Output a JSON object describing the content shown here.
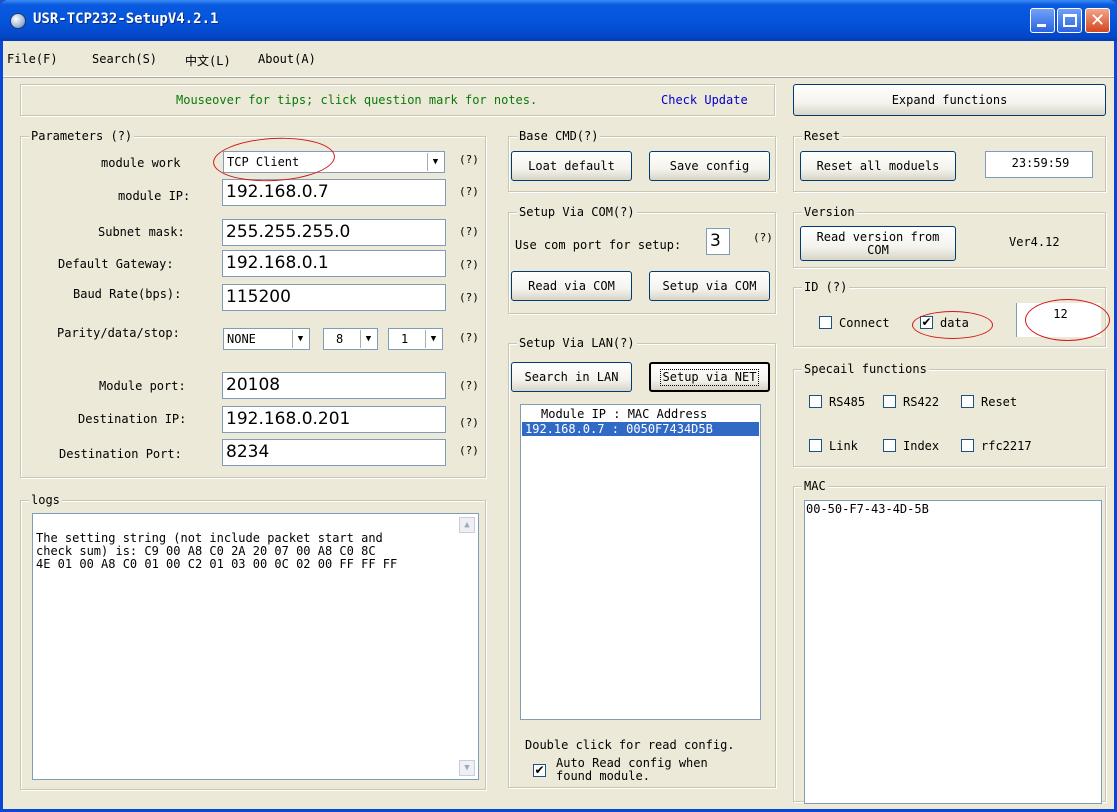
{
  "window": {
    "title": "USR-TCP232-SetupV4.2.1"
  },
  "menu": [
    "File(F)",
    "Search(S)",
    "中文(L)",
    "About(A)"
  ],
  "tips": {
    "text": "Mouseover for tips; click question mark for notes.",
    "check_update": "Check Update"
  },
  "expand_button": "Expand functions",
  "parameters": {
    "title": "Parameters (?)",
    "help": "(?)",
    "module_work_label": "module work",
    "module_work_value": "TCP Client",
    "module_ip_label": "module IP:",
    "module_ip_value": "192.168.0.7",
    "subnet_label": "Subnet mask:",
    "subnet_value": "255.255.255.0",
    "gateway_label": "Default Gateway:",
    "gateway_value": "192.168.0.1",
    "baud_label": "Baud Rate(bps):",
    "baud_value": "115200",
    "parity_label": "Parity/data/stop:",
    "parity_value": "NONE",
    "data_bits_value": "8",
    "stop_bits_value": "1",
    "module_port_label": "Module port:",
    "module_port_value": "20108",
    "dest_ip_label": "Destination IP:",
    "dest_ip_value": "192.168.0.201",
    "dest_port_label": "Destination Port:",
    "dest_port_value": "8234"
  },
  "logs": {
    "title": "logs",
    "lines": [
      "The setting string (not include packet start and",
      "check sum) is:  C9 00 A8 C0 2A 20 07 00 A8 C0 8C",
      "4E 01 00 A8 C0 01 00 C2 01 03 00 0C 02 00 FF FF FF"
    ]
  },
  "base_cmd": {
    "title": "Base CMD(?)",
    "load_default": "Loat default",
    "save_config": "Save config"
  },
  "setup_com": {
    "title": "Setup Via COM(?)",
    "port_label": "Use com port for setup:",
    "port_value": "3",
    "help": "(?)",
    "read_button": "Read via COM",
    "setup_button": "Setup via COM"
  },
  "setup_lan": {
    "title": "Setup Via LAN(?)",
    "search_button": "Search in LAN",
    "setup_button": "Setup via NET",
    "list_header": "Module IP  :  MAC Address",
    "list_items": [
      "192.168.0.7 : 0050F7434D5B"
    ],
    "hint": "Double click for read config.",
    "auto_read_label_1": "Auto Read config when",
    "auto_read_label_2": "found module.",
    "auto_read_checked": true
  },
  "reset": {
    "title": "Reset",
    "button": "Reset all moduels",
    "time_value": "23:59:59"
  },
  "version": {
    "title": "Version",
    "button_line1": "Read version from",
    "button_line2": "COM",
    "value": "Ver4.12"
  },
  "id": {
    "title": "ID (?)",
    "connect_label": "Connect",
    "connect_checked": false,
    "data_label": "data",
    "data_checked": true,
    "value": "12"
  },
  "special": {
    "title": "Specail functions",
    "rs485": "RS485",
    "rs422": "RS422",
    "reset": "Reset",
    "link": "Link",
    "index": "Index",
    "rfc2217": "rfc2217"
  },
  "mac": {
    "title": "MAC",
    "value": "00-50-F7-43-4D-5B"
  },
  "colors": {
    "title_bar": "#0455dc",
    "window_bg": "#ece9d8",
    "tips_text": "#0a7a0a",
    "link": "#0000cc",
    "highlight": "#316ac5",
    "annotation": "#d21818"
  }
}
